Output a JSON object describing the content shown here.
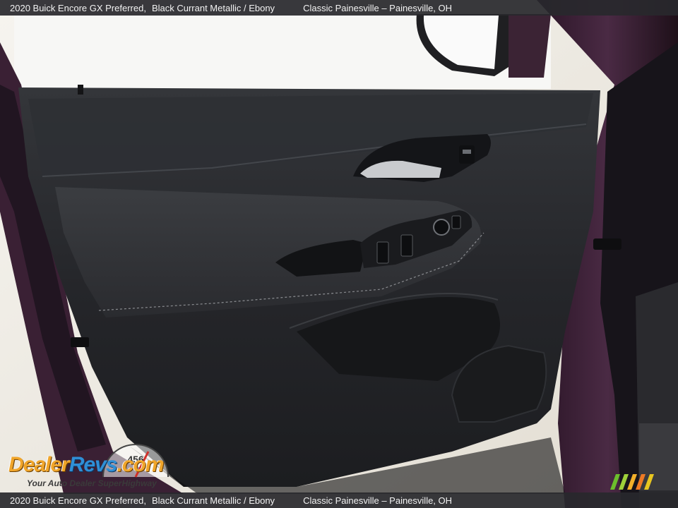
{
  "caption": {
    "vehicle": "2020 Buick Encore GX Preferred,",
    "trim": "Black Currant Metallic / Ebony",
    "dealer": "Classic Painesville – Painesville, OH"
  },
  "watermark": {
    "brand_part1": "Dealer",
    "brand_part2": "Revs",
    "brand_suffix": ".com",
    "tagline": "Your Auto Dealer SuperHighway",
    "gauge_digits": "456"
  },
  "colors": {
    "caption_bar": "#28282c",
    "door_panel": "#262729",
    "body_paint": "#2e1a2a",
    "logo_orange": "#f0a52a",
    "logo_blue": "#2f8fd6"
  }
}
